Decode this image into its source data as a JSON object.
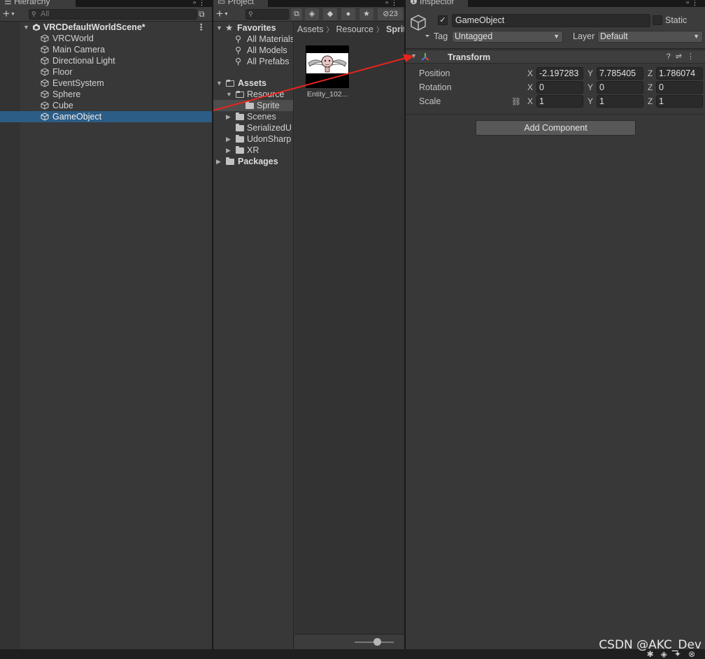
{
  "hierarchy": {
    "tab_label": "Hierarchy",
    "search_placeholder": "All",
    "scene_name": "VRCDefaultWorldScene*",
    "items": [
      {
        "label": "VRCWorld"
      },
      {
        "label": "Main Camera"
      },
      {
        "label": "Directional Light"
      },
      {
        "label": "Floor"
      },
      {
        "label": "EventSystem"
      },
      {
        "label": "Sphere"
      },
      {
        "label": "Cube"
      },
      {
        "label": "GameObject",
        "selected": true
      }
    ]
  },
  "project": {
    "tab_label": "Project",
    "hidden_count": "23",
    "favorites": {
      "label": "Favorites",
      "items": [
        "All Materials",
        "All Models",
        "All Prefabs"
      ]
    },
    "assets": {
      "label": "Assets",
      "items": [
        "Resource",
        "Sprite",
        "Scenes",
        "SerializedU",
        "UdonSharp",
        "XR"
      ]
    },
    "packages_label": "Packages",
    "breadcrumb": [
      "Assets",
      "Resource",
      "Sprite"
    ],
    "asset_files": [
      {
        "name": "Entity_102..."
      }
    ]
  },
  "inspector": {
    "tab_label": "Inspector",
    "object_name": "GameObject",
    "active": true,
    "static_label": "Static",
    "tag_label": "Tag",
    "tag_value": "Untagged",
    "layer_label": "Layer",
    "layer_value": "Default",
    "component_title": "Transform",
    "position": {
      "label": "Position",
      "x": "-2.197283",
      "y": "7.785405",
      "z": "1.786074"
    },
    "rotation": {
      "label": "Rotation",
      "x": "0",
      "y": "0",
      "z": "0"
    },
    "scale": {
      "label": "Scale",
      "x": "1",
      "y": "1",
      "z": "1"
    },
    "axis_labels": {
      "x": "X",
      "y": "Y",
      "z": "Z"
    },
    "add_component_label": "Add Component"
  },
  "watermark": "CSDN @AKC_Dev",
  "colors": {
    "selection": "#2c5d87",
    "arrow": "#e8241e",
    "panel_bg": "#383838"
  }
}
